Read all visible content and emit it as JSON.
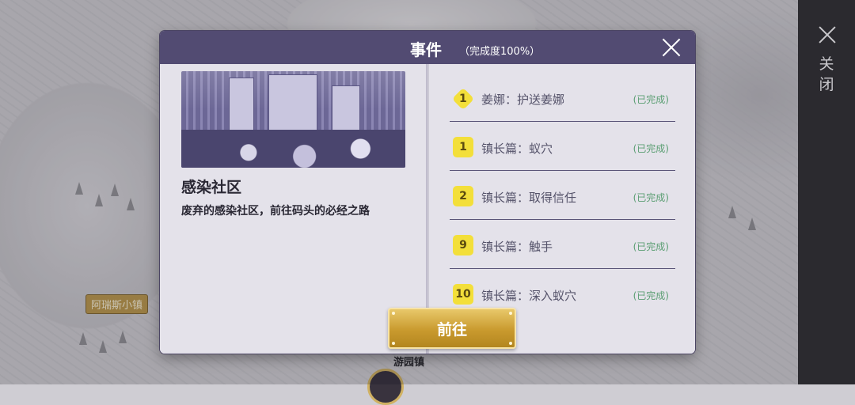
{
  "map": {
    "town_label": "阿瑞斯小镇",
    "location_label": "游园镇"
  },
  "side_panel": {
    "close_label": "关闭",
    "close_icon": "close-x-icon"
  },
  "dialog": {
    "title": "事件",
    "progress": "（完成度100%）",
    "close_icon": "close-x-icon"
  },
  "event": {
    "name": "感染社区",
    "description": "废弃的感染社区，前往码头的必经之路"
  },
  "tasks": [
    {
      "badge": "1",
      "badge_shape": "diamond",
      "name": "姜娜：护送姜娜",
      "status": "(已完成)"
    },
    {
      "badge": "1",
      "badge_shape": "puzzle",
      "name": "镇长篇：蚁穴",
      "status": "(已完成)"
    },
    {
      "badge": "2",
      "badge_shape": "puzzle",
      "name": "镇长篇：取得信任",
      "status": "(已完成)"
    },
    {
      "badge": "9",
      "badge_shape": "puzzle",
      "name": "镇长篇：触手",
      "status": "(已完成)"
    },
    {
      "badge": "10",
      "badge_shape": "puzzle",
      "name": "镇长篇：深入蚁穴",
      "status": "(已完成)"
    }
  ],
  "actions": {
    "go_label": "前往"
  },
  "colors": {
    "header": "#524b72",
    "panel": "#e4e2ea",
    "badge": "#f3df3a",
    "status": "#5a9e72",
    "button": "#c99a2e"
  }
}
